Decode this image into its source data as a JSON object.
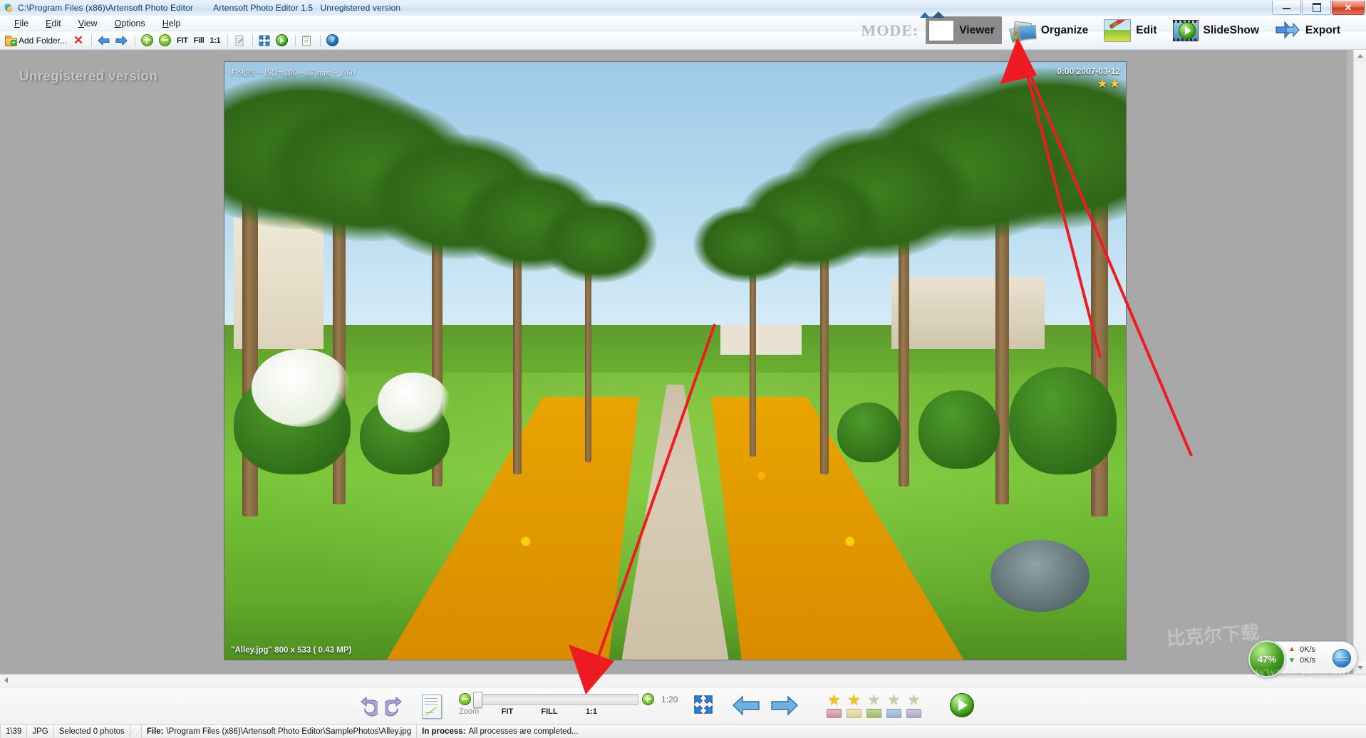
{
  "window": {
    "title_path": "C:\\Program Files (x86)\\Artensoft Photo Editor",
    "title_app": "Artensoft Photo Editor 1.5",
    "title_license": "Unregistered version",
    "app_icon": "photo-app-icon",
    "minimize_label": "Minimize",
    "maximize_label": "Restore",
    "close_label": "Close"
  },
  "menu": {
    "items": [
      {
        "label": "File",
        "accel": "F"
      },
      {
        "label": "Edit",
        "accel": "E"
      },
      {
        "label": "View",
        "accel": "V"
      },
      {
        "label": "Options",
        "accel": "O"
      },
      {
        "label": "Help",
        "accel": "H"
      }
    ]
  },
  "toolbar": {
    "add_folder_label": "Add Folder...",
    "add_folder_icon": "folder-add-icon",
    "remove_icon": "red-x-delete-icon",
    "prev_icon": "blue-arrow-left-icon",
    "next_icon": "blue-arrow-right-icon",
    "zoom_in_icon": "green-plus-circle-icon",
    "zoom_out_icon": "green-minus-circle-icon",
    "fit_label": "FIT",
    "fill_label": "Fill",
    "one_to_one_label": "1:1",
    "rename_icon": "document-edit-icon",
    "fullscreen_icon": "fullscreen-four-arrows-icon",
    "slideshow_icon": "green-play-circle-icon",
    "notes_icon": "notepad-icon",
    "help_icon": "blue-question-help-icon"
  },
  "mode": {
    "label": "MODE:",
    "buttons": [
      {
        "label": "Viewer",
        "icon": "viewer-thumbnail-icon",
        "active": true
      },
      {
        "label": "Organize",
        "icon": "photo-stack-icon",
        "active": false
      },
      {
        "label": "Edit",
        "icon": "brush-landscape-icon",
        "active": false
      },
      {
        "label": "SlideShow",
        "icon": "film-play-icon",
        "active": false
      },
      {
        "label": "Export",
        "icon": "blue-export-arrow-icon",
        "active": false
      }
    ]
  },
  "left_panel": {
    "watermark": "Unregistered version"
  },
  "photo": {
    "exif": "F/9,99 ~ ISO=100 ~ 17 mm ~ 1/60",
    "filename_info": "\"Alley.jpg\"  800 x 533 ( 0.43 MP)",
    "date_info": "0:00 2007-03-12",
    "rating": 2,
    "rating_max": 2,
    "alt": "palm-tree-alley-garden-photo"
  },
  "controls": {
    "rotate_ccw_icon": "rotate-counterclockwise-icon",
    "rotate_cw_icon": "rotate-clockwise-icon",
    "rename_icon": "document-rename-icon",
    "zoom_out_icon": "green-minus-circle-icon",
    "zoom_in_icon": "green-plus-circle-icon",
    "zoom_label": "Zoom",
    "fit_label": "FIT",
    "fill_label": "FILL",
    "one_to_one_label": "1:1",
    "zoom_ratio": "1:20",
    "slider_percent": 2,
    "fullscreen_icon": "fullscreen-four-arrows-icon",
    "prev_icon": "blue-arrow-left-large-icon",
    "next_icon": "blue-arrow-right-large-icon",
    "play_icon": "green-play-large-icon",
    "stars": [
      {
        "filled": true,
        "chip": "#d39aa0"
      },
      {
        "filled": true,
        "chip": "#ddd49a"
      },
      {
        "filled": false,
        "chip": "#a9bf72"
      },
      {
        "filled": false,
        "chip": "#9cb9d2"
      },
      {
        "filled": false,
        "chip": "#bdb3cc"
      }
    ]
  },
  "status": {
    "index": "1\\39",
    "format": "JPG",
    "selection": "Selected 0 photos",
    "file_key": "File:",
    "file_value": "\\Program Files (x86)\\Artensoft Photo Editor\\SamplePhotos\\Alley.jpg",
    "process_key": "In process:",
    "process_value": "All processes are completed..."
  },
  "net_widget": {
    "cpu": "47%",
    "up_rate": "0K/s",
    "down_rate": "0K/s",
    "up_icon": "arrow-up-icon",
    "down_icon": "arrow-down-icon",
    "globe_icon": "network-globe-icon"
  },
  "site_watermarks": {
    "line1": "比克尔下载",
    "line2": "www.2345.com"
  },
  "colors": {
    "accent_green": "#4fb022",
    "accent_red": "#d8332a",
    "accent_blue": "#1f74c4",
    "mode_active_bg": "#8b8b8b",
    "canvas_bg": "#a8a8a8",
    "annotation_red": "#ee1c22"
  }
}
